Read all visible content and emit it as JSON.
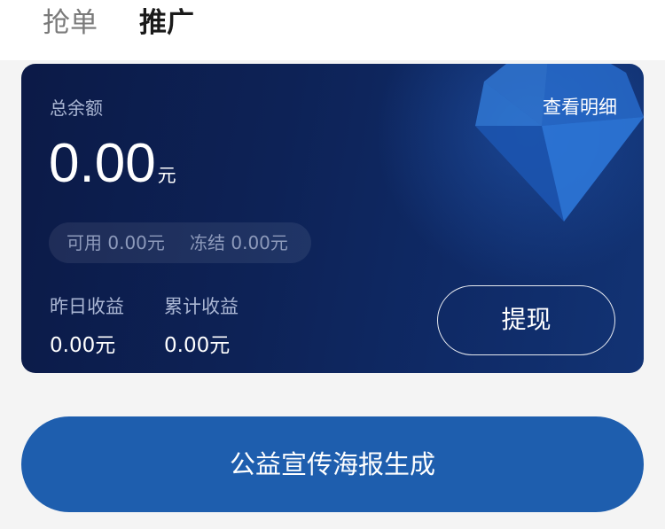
{
  "tabs": [
    {
      "label": "抢单",
      "active": false
    },
    {
      "label": "推广",
      "active": true
    }
  ],
  "card": {
    "total_label": "总余额",
    "details_link": "查看明细",
    "balance_amount": "0.00",
    "balance_unit": "元",
    "available": "可用 0.00元",
    "frozen": "冻结 0.00元",
    "yesterday_label": "昨日收益",
    "yesterday_value": "0.00元",
    "cumulative_label": "累计收益",
    "cumulative_value": "0.00元",
    "withdraw_button": "提现",
    "decoration_icon": "diamond-icon"
  },
  "poster_button": "公益宣传海报生成",
  "colors": {
    "card_bg": "#0d2256",
    "button_blue": "#1e5eae",
    "page_bg": "#f4f4f4"
  }
}
